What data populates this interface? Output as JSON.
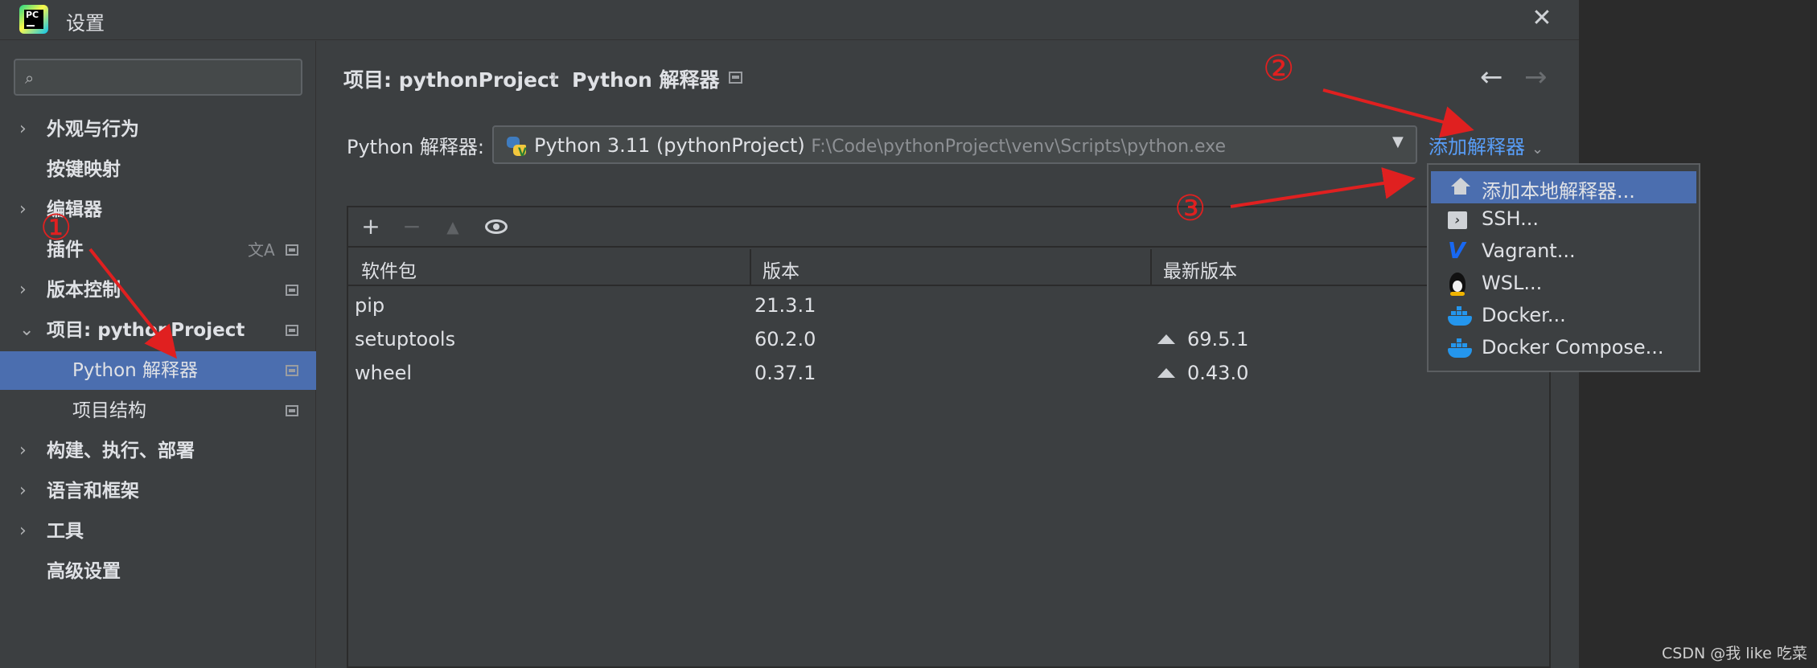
{
  "window": {
    "title": "设置",
    "logo_text": "PC"
  },
  "sidebar": {
    "search_placeholder": "",
    "items": [
      {
        "label": "外观与行为",
        "expandable": true
      },
      {
        "label": "按键映射",
        "expandable": false
      },
      {
        "label": "编辑器",
        "expandable": true
      },
      {
        "label": "插件",
        "expandable": false
      },
      {
        "label": "版本控制",
        "expandable": true
      },
      {
        "label": "项目: pythonProject",
        "expandable": true,
        "expanded": true
      },
      {
        "label": "Python 解释器",
        "selected": true
      },
      {
        "label": "项目结构"
      },
      {
        "label": "构建、执行、部署",
        "expandable": true
      },
      {
        "label": "语言和框架",
        "expandable": true
      },
      {
        "label": "工具",
        "expandable": true
      },
      {
        "label": "高级设置",
        "expandable": false
      }
    ]
  },
  "breadcrumb": {
    "project": "项目: pythonProject",
    "separator": "›",
    "page": "Python 解释器"
  },
  "interpreter": {
    "label": "Python 解释器:",
    "name": "Python 3.11 (pythonProject)",
    "path": "F:\\Code\\pythonProject\\venv\\Scripts\\python.exe",
    "add_link": "添加解释器"
  },
  "packages": {
    "columns": [
      "软件包",
      "版本",
      "最新版本"
    ],
    "rows": [
      {
        "name": "pip",
        "version": "21.3.1",
        "latest": ""
      },
      {
        "name": "setuptools",
        "version": "60.2.0",
        "latest": "69.5.1"
      },
      {
        "name": "wheel",
        "version": "0.37.1",
        "latest": "0.43.0"
      }
    ]
  },
  "add_menu": {
    "items": [
      {
        "label": "添加本地解释器...",
        "icon": "home-icon"
      },
      {
        "label": "SSH...",
        "icon": "terminal-icon"
      },
      {
        "label": "Vagrant...",
        "icon": "vagrant-icon"
      },
      {
        "label": "WSL...",
        "icon": "linux-icon"
      },
      {
        "label": "Docker...",
        "icon": "docker-icon"
      },
      {
        "label": "Docker Compose...",
        "icon": "docker-icon"
      }
    ]
  },
  "annotations": {
    "step1": "①",
    "step2": "②",
    "step3": "③"
  },
  "watermark": "CSDN @我 like 吃菜",
  "colors": {
    "accent": "#4b6eaf",
    "link": "#589df6",
    "annotation": "#e02020",
    "panel": "#3c3f41"
  }
}
